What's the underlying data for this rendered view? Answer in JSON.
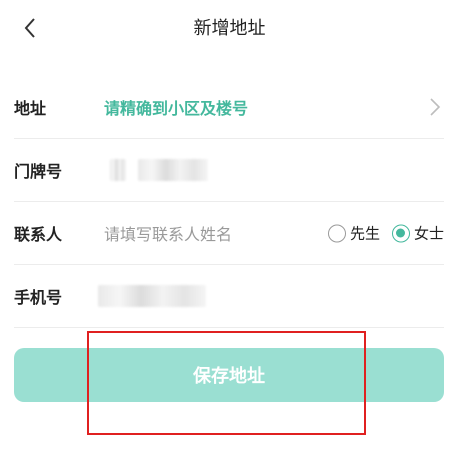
{
  "header": {
    "title": "新增地址",
    "back_icon": "chevron-left-icon"
  },
  "form": {
    "address": {
      "label": "地址",
      "value": "请精确到小区及楼号",
      "icon": "chevron-right-icon",
      "accent": "#44b89d"
    },
    "house_number": {
      "label": "门牌号"
    },
    "contact": {
      "label": "联系人",
      "placeholder": "请填写联系人姓名",
      "options": [
        {
          "label": "先生",
          "checked": false
        },
        {
          "label": "女士",
          "checked": true
        }
      ]
    },
    "phone": {
      "label": "手机号"
    }
  },
  "save_button": {
    "label": "保存地址",
    "color": "#9adfd2"
  },
  "annotation": {
    "color": "#e02020"
  }
}
